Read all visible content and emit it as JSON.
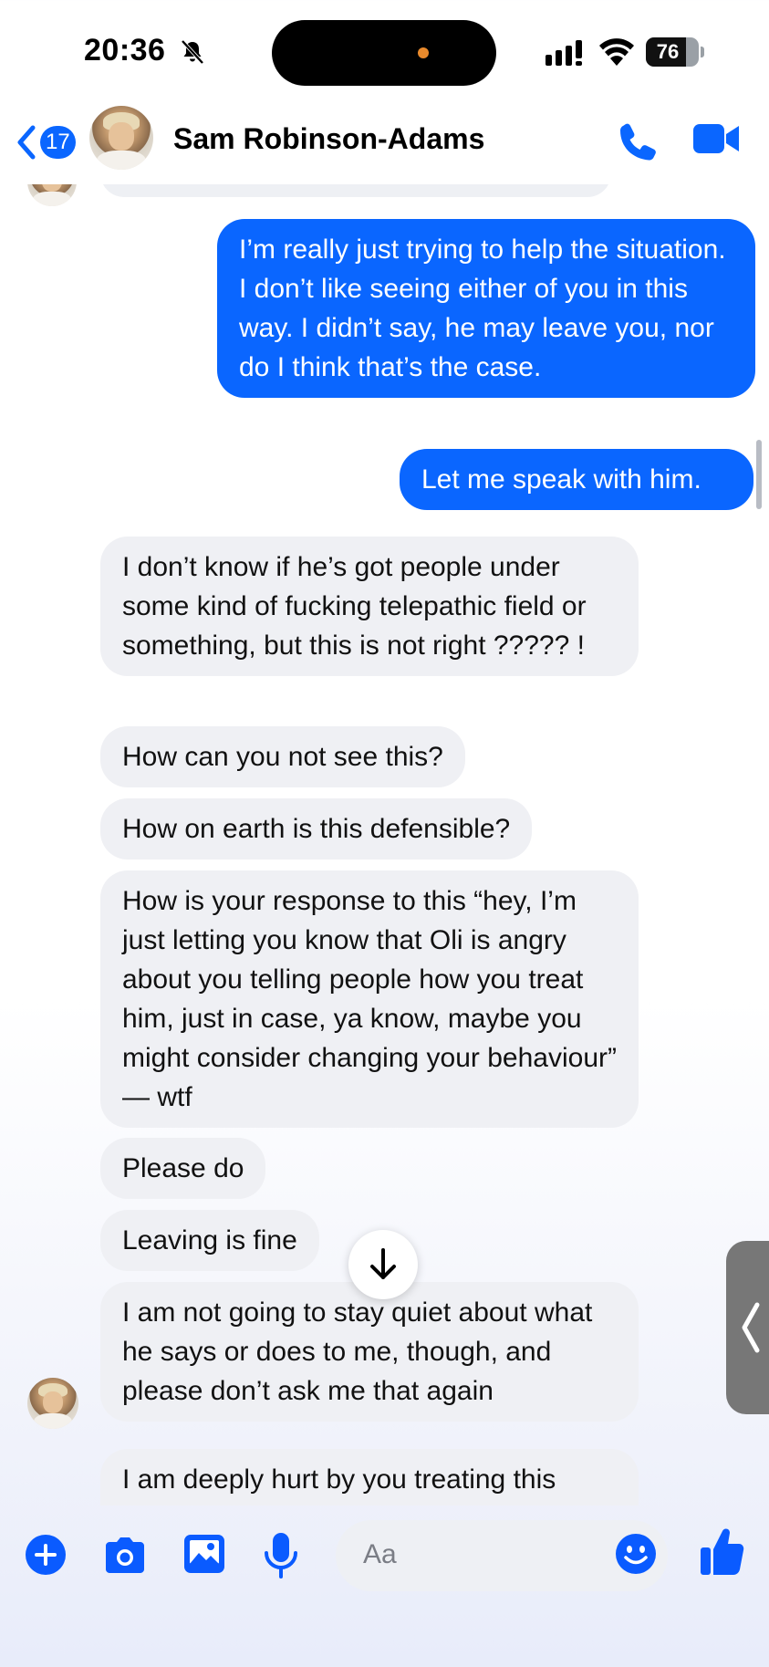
{
  "status_bar": {
    "time": "20:36",
    "battery": "76",
    "battery_level": 0.76
  },
  "header": {
    "back_count": "17",
    "contact_name": "Sam Robinson-Adams",
    "accent_color": "#0a66ff"
  },
  "messages": [
    {
      "direction": "outgoing",
      "text": "I’m really just trying to help the situation. I don’t like seeing either of you in this way. I didn’t say, he may leave you, nor do I think that’s the case."
    },
    {
      "direction": "outgoing",
      "text": "Let me speak with him."
    },
    {
      "direction": "incoming",
      "text": "I don’t know if he’s got people under some kind of fucking telepathic field or something, but this is not right ????? !"
    },
    {
      "direction": "incoming",
      "text": "How can you not see this?"
    },
    {
      "direction": "incoming",
      "text": "How on earth is this defensible?"
    },
    {
      "direction": "incoming",
      "text": "How is your response to this “hey, I’m just letting you know that Oli is angry about you telling people how you treat him, just in case, ya know, maybe you might consider changing your behaviour” — wtf"
    },
    {
      "direction": "incoming",
      "text": "Please do"
    },
    {
      "direction": "incoming",
      "text": "Leaving is fine"
    },
    {
      "direction": "incoming",
      "text": "I am not going to stay quiet about what he says or does to me, though, and please don’t ask me that again"
    },
    {
      "direction": "incoming",
      "text": "I am deeply hurt by you treating this"
    }
  ],
  "composer": {
    "placeholder": "Aa",
    "icons": [
      "plus-icon",
      "camera-icon",
      "gallery-icon",
      "microphone-icon",
      "emoji-icon",
      "thumbs-up-icon"
    ]
  }
}
